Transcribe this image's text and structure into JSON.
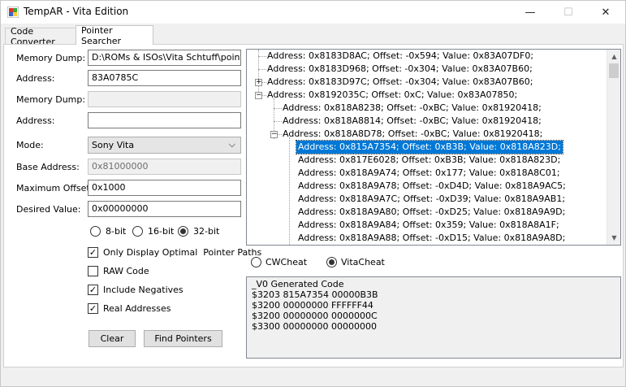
{
  "window": {
    "title": "TempAR - Vita Edition",
    "min": "—",
    "max": "☐",
    "close": "✕"
  },
  "tabs": [
    {
      "label": "Code Converter"
    },
    {
      "label": "Pointer Searcher"
    }
  ],
  "form": {
    "memory_dump_label": "Memory Dump:",
    "memory_dump_value": "D:\\ROMs & ISOs\\Vita Schtuff\\pointer_",
    "address_label": "Address:",
    "address_value": "83A0785C",
    "memory_dump2_label": "Memory Dump:",
    "memory_dump2_value": "",
    "address2_label": "Address:",
    "address2_value": "",
    "mode_label": "Mode:",
    "mode_value": "Sony Vita",
    "base_address_label": "Base Address:",
    "base_address_value": "0x81000000",
    "max_offset_label": "Maximum Offset:",
    "max_offset_value": "0x1000",
    "desired_value_label": "Desired Value:",
    "desired_value_value": "0x00000000"
  },
  "bits": [
    {
      "label": "8-bit",
      "selected": false
    },
    {
      "label": "16-bit",
      "selected": false
    },
    {
      "label": "32-bit",
      "selected": true
    }
  ],
  "options": [
    {
      "label": "Only Display Optimal  Pointer Paths",
      "checked": true
    },
    {
      "label": "RAW Code",
      "checked": false
    },
    {
      "label": "Include Negatives",
      "checked": true
    },
    {
      "label": "Real Addresses",
      "checked": true
    }
  ],
  "buttons": {
    "clear": "Clear",
    "find": "Find Pointers"
  },
  "tree": [
    "Address: 0x8183D8AC; Offset: -0x594; Value: 0x83A07DF0;",
    "Address: 0x8183D968; Offset: -0x304; Value: 0x83A07B60;",
    "Address: 0x8183D97C; Offset: -0x304; Value: 0x83A07B60;",
    "Address: 0x8192035C; Offset: 0xC; Value: 0x83A07850;",
    "Address: 0x818A8238; Offset: -0xBC; Value: 0x81920418;",
    "Address: 0x818A8814; Offset: -0xBC; Value: 0x81920418;",
    "Address: 0x818A8D78; Offset: -0xBC; Value: 0x81920418;",
    "Address: 0x815A7354; Offset: 0xB3B; Value: 0x818A823D;",
    "Address: 0x817E6028; Offset: 0xB3B; Value: 0x818A823D;",
    "Address: 0x818A9A74; Offset: 0x177; Value: 0x818A8C01;",
    "Address: 0x818A9A78; Offset: -0xD4D; Value: 0x818A9AC5;",
    "Address: 0x818A9A7C; Offset: -0xD39; Value: 0x818A9AB1;",
    "Address: 0x818A9A80; Offset: -0xD25; Value: 0x818A9A9D;",
    "Address: 0x818A9A84; Offset: 0x359; Value: 0x818A8A1F;",
    "Address: 0x818A9A88; Offset: -0xD15; Value: 0x818A9A8D;"
  ],
  "tree_expanders": {
    "plus": "+",
    "minus": "−"
  },
  "output": [
    {
      "label": "CWCheat",
      "selected": false
    },
    {
      "label": "VitaCheat",
      "selected": true
    }
  ],
  "code": [
    "_V0 Generated Code",
    "$3203 815A7354 00000B3B",
    "$3200 00000000 FFFFFF44",
    "$3200 00000000 0000000C",
    "$3300 00000000 00000000"
  ],
  "scroll": {
    "up": "▲",
    "down": "▼"
  },
  "chevron": "⌵",
  "checkmark": "✓"
}
